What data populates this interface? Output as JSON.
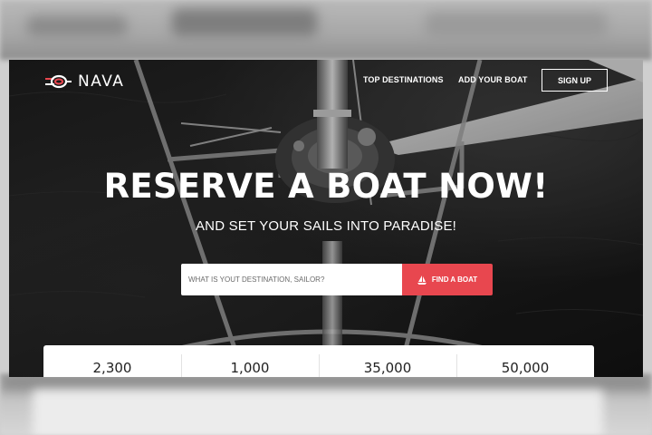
{
  "brand": {
    "name": "NAVA",
    "logo_icon": "nautical-knot-icon"
  },
  "nav": {
    "links": [
      "TOP DESTINATIONS",
      "ADD YOUR BOAT"
    ],
    "signup_label": "SIGN UP"
  },
  "hero": {
    "headline": "RESERVE A BOAT NOW!",
    "subheadline": "AND SET YOUR SAILS INTO PARADISE!"
  },
  "search": {
    "placeholder": "WHAT IS YOUT DESTINATION, SAILOR?",
    "button_label": "FIND A BOAT",
    "button_icon": "sailboat-icon"
  },
  "stats": [
    "2,300",
    "1,000",
    "35,000",
    "50,000"
  ],
  "colors": {
    "accent": "#e8474f",
    "text_on_dark": "#ffffff",
    "stats_bg": "#ffffff"
  }
}
